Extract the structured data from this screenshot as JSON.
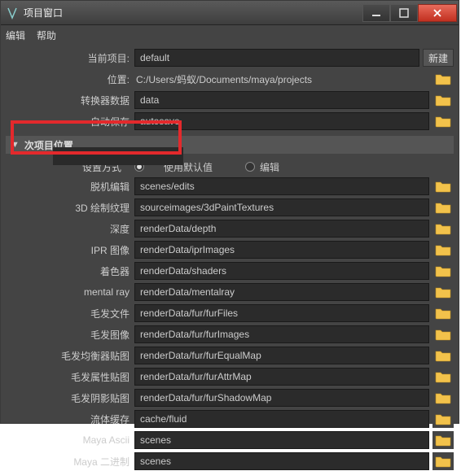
{
  "window": {
    "title": "项目窗口"
  },
  "menubar": {
    "edit": "编辑",
    "help": "帮助"
  },
  "top": {
    "current_project_label": "当前项目:",
    "current_project_value": "default",
    "new_btn": "新建",
    "location_label": "位置:",
    "location_value": "C:/Users/蚂蚁/Documents/maya/projects"
  },
  "top_rows": [
    {
      "label": "转换器数据",
      "value": "data"
    },
    {
      "label": "自动保存",
      "value": "autosave"
    }
  ],
  "section": {
    "title": "次项目位置"
  },
  "radio": {
    "setting_label": "设置方式",
    "opt1": "使用默认值",
    "opt2": "编辑"
  },
  "rows": [
    {
      "label": "脱机编辑",
      "value": "scenes/edits"
    },
    {
      "label": "3D 绘制纹理",
      "value": "sourceimages/3dPaintTextures"
    },
    {
      "label": "深度",
      "value": "renderData/depth"
    },
    {
      "label": "IPR 图像",
      "value": "renderData/iprImages"
    },
    {
      "label": "着色器",
      "value": "renderData/shaders"
    },
    {
      "label": "mental ray",
      "value": "renderData/mentalray"
    },
    {
      "label": "毛发文件",
      "value": "renderData/fur/furFiles"
    },
    {
      "label": "毛发图像",
      "value": "renderData/fur/furImages"
    },
    {
      "label": "毛发均衡器贴图",
      "value": "renderData/fur/furEqualMap"
    },
    {
      "label": "毛发属性贴图",
      "value": "renderData/fur/furAttrMap"
    },
    {
      "label": "毛发阴影贴图",
      "value": "renderData/fur/furShadowMap"
    },
    {
      "label": "流体缓存",
      "value": "cache/fluid"
    },
    {
      "label": "Maya Ascii",
      "value": "scenes"
    },
    {
      "label": "Maya 二进制",
      "value": "scenes"
    }
  ]
}
